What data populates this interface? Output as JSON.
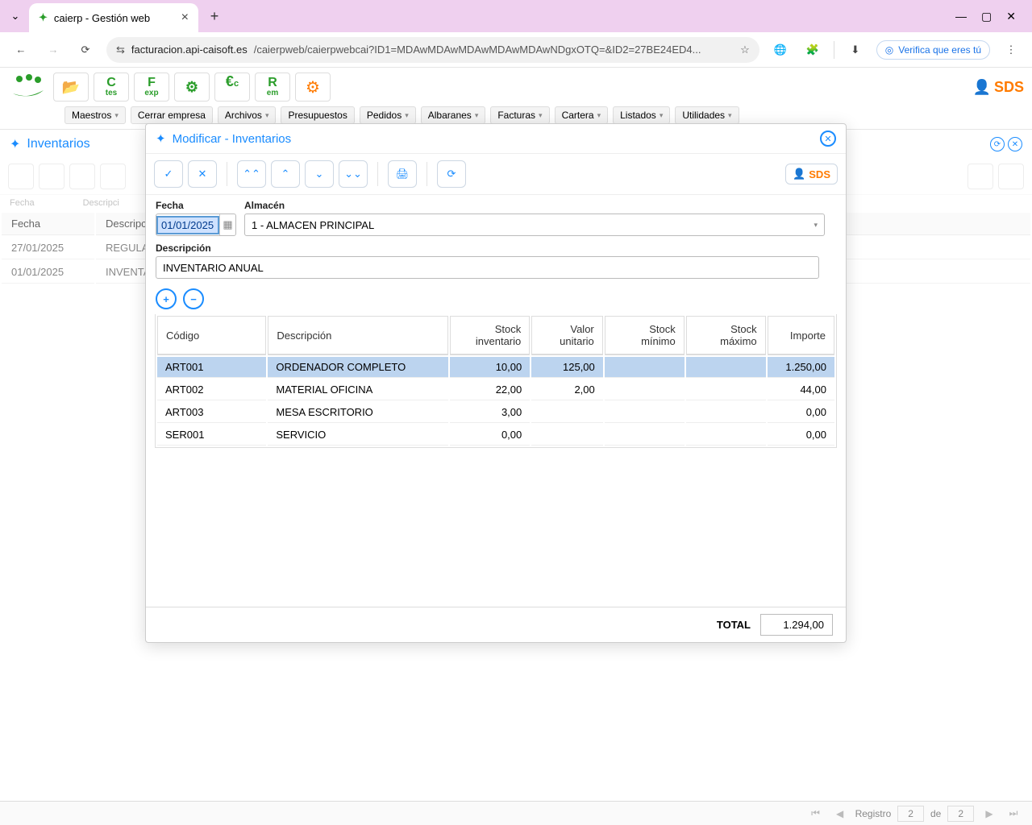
{
  "browser": {
    "tab_title": "caierp - Gestión web",
    "url_domain": "facturacion.api-caisoft.es",
    "url_path": "/caierpweb/caierpwebcai?ID1=MDAwMDAwMDAwMDAwMDAwNDgxOTQ=&ID2=27BE24ED4...",
    "verify_label": "Verifica que eres tú"
  },
  "toolbar_letters": {
    "c_tes": "C",
    "c_tes_sub": "tes",
    "f_exp": "F",
    "f_exp_sub": "exp",
    "euro": "€",
    "euro_sub": "c",
    "r_em": "R",
    "r_em_sub": "em"
  },
  "sds_label": "SDS",
  "menu": [
    "Maestros",
    "Cerrar empresa",
    "Archivos",
    "Presupuestos",
    "Pedidos",
    "Albaranes",
    "Facturas",
    "Cartera",
    "Listados",
    "Utilidades"
  ],
  "section_title": "Inventarios",
  "bg_filters": {
    "fecha": "Fecha",
    "descripcion": "Descripci"
  },
  "bg_headers": {
    "fecha": "Fecha",
    "descripcion": "Descripci"
  },
  "bg_rows": [
    {
      "fecha": "27/01/2025",
      "desc": "REGULA"
    },
    {
      "fecha": "01/01/2025",
      "desc": "INVENTA"
    }
  ],
  "modal": {
    "title": "Modificar - Inventarios",
    "fecha_label": "Fecha",
    "fecha_value": "01/01/2025",
    "almacen_label": "Almacén",
    "almacen_value": "1 - ALMACEN PRINCIPAL",
    "descripcion_label": "Descripción",
    "descripcion_value": "INVENTARIO ANUAL",
    "grid_headers": {
      "codigo": "Código",
      "descripcion": "Descripción",
      "stock_inv": "Stock inventario",
      "valor_unit": "Valor unitario",
      "stock_min": "Stock mínimo",
      "stock_max": "Stock máximo",
      "importe": "Importe"
    },
    "rows": [
      {
        "codigo": "ART001",
        "desc": "ORDENADOR COMPLETO",
        "stock": "10,00",
        "valor": "125,00",
        "min": "",
        "max": "",
        "importe": "1.250,00"
      },
      {
        "codigo": "ART002",
        "desc": "MATERIAL OFICINA",
        "stock": "22,00",
        "valor": "2,00",
        "min": "",
        "max": "",
        "importe": "44,00"
      },
      {
        "codigo": "ART003",
        "desc": "MESA ESCRITORIO",
        "stock": "3,00",
        "valor": "",
        "min": "",
        "max": "",
        "importe": "0,00"
      },
      {
        "codigo": "SER001",
        "desc": "SERVICIO",
        "stock": "0,00",
        "valor": "",
        "min": "",
        "max": "",
        "importe": "0,00"
      }
    ],
    "total_label": "TOTAL",
    "total_value": "1.294,00"
  },
  "status": {
    "registro": "Registro",
    "current": "2",
    "de": "de",
    "total": "2"
  }
}
